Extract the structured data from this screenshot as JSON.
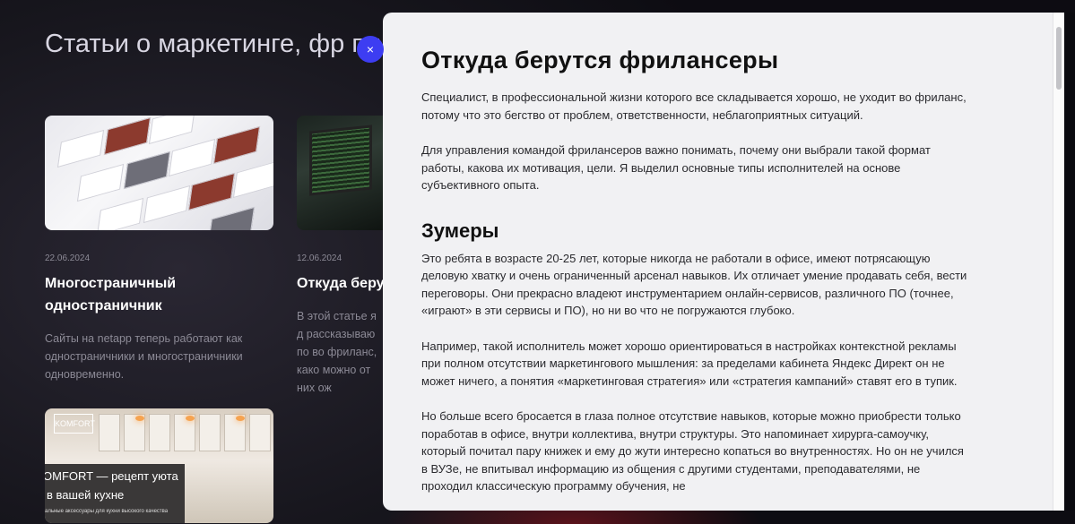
{
  "page": {
    "title": "Статьи о маркетинге, фр платформы"
  },
  "cards": [
    {
      "date": "22.06.2024",
      "title": "Многостраничный одностраничник",
      "desc": "Сайты на netapp теперь работают как одностраничники и многостраничники одновременно."
    },
    {
      "date": "12.06.2024",
      "title": "Откуда беру",
      "desc": "В этой статье я д рассказываю по во фриланс, како можно от них ож"
    },
    {
      "image_text": {
        "logo": "KOMFORT",
        "line1": "OMFORT — рецепт уюта",
        "line2": "в вашей кухне",
        "line3": "альные аксессуары для кухни высокого качества"
      }
    }
  ],
  "modal": {
    "close_label": "×",
    "heading": "Откуда берутся фрилансеры",
    "p1": "Специалист, в профессиональной жизни которого все складывается хорошо, не уходит во фриланс, потому что это бегство от проблем, ответственности, неблагоприятных ситуаций.",
    "p2": "Для управления командой фрилансеров важно понимать, почему они выбрали такой формат работы, какова их мотивация, цели. Я выделил основные типы исполнителей на основе субъективного опыта.",
    "subheading": "Зумеры",
    "p3": "Это ребята в возрасте 20-25 лет, которые никогда не работали в офисе, имеют потрясающую деловую хватку и очень ограниченный арсенал навыков. Их отличает умение продавать себя, вести переговоры. Они прекрасно владеют инструментарием онлайн-сервисов, различного ПО (точнее, «играют» в эти сервисы и ПО), но ни во что не погружаются глубоко.",
    "p4": "Например, такой исполнитель может хорошо ориентироваться в настройках контекстной рекламы при полном отсутствии маркетингового мышления: за пределами кабинета Яндекс Директ он не может ничего, а понятия «маркетинговая стратегия» или «стратегия кампаний» ставят его в тупик.",
    "p5": "Но больше всего бросается в глаза полное отсутствие навыков, которые можно приобрести только поработав в офисе, внутри коллектива, внутри структуры. Это напоминает хирурга-самоучку, который почитал пару книжек и ему до жути интересно копаться во внутренностях. Но он не учился в ВУЗе, не впитывал информацию из общения с другими студентами, преподавателями, не проходил классическую программу обучения, не"
  },
  "colors": {
    "close_button": "#3d3df2",
    "modal_bg": "#f1f1f3",
    "page_bg": "#17161d"
  }
}
